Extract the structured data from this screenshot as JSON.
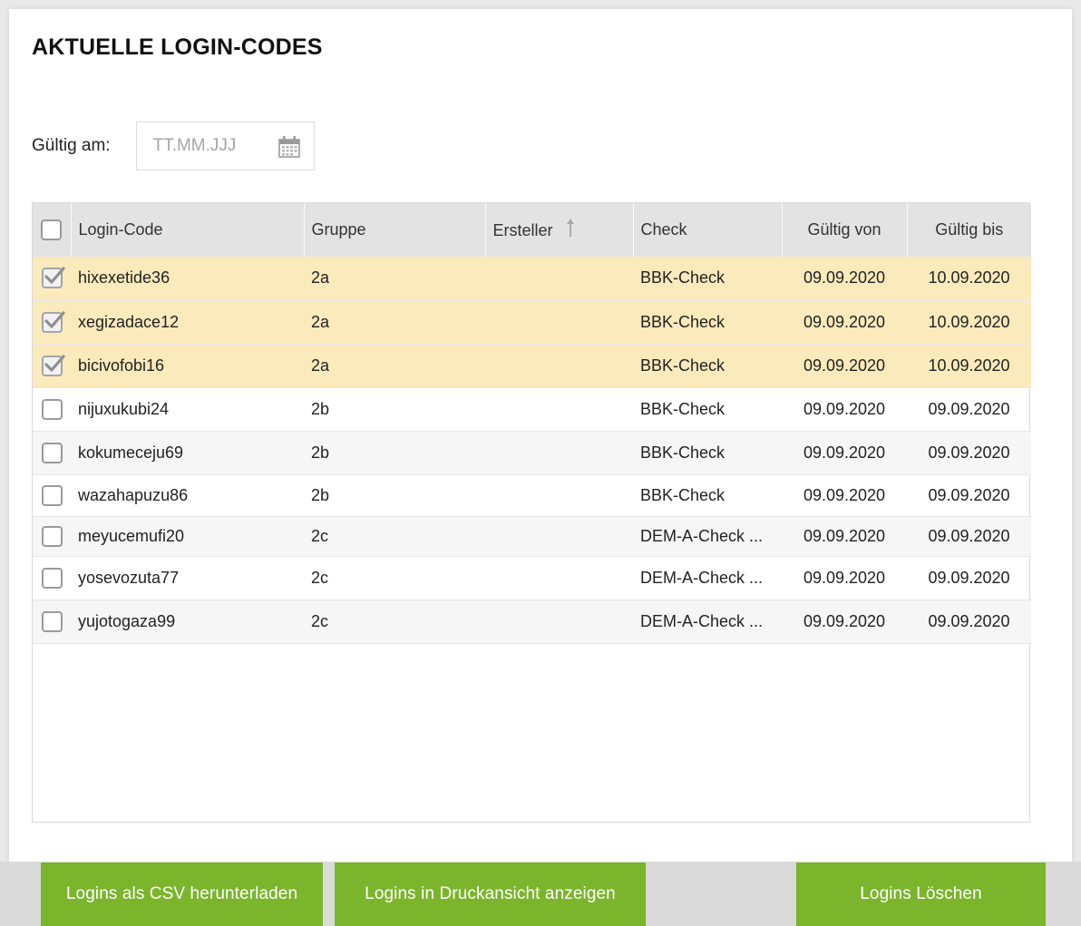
{
  "title": "AKTUELLE LOGIN-CODES",
  "filter": {
    "label": "Gültig am:",
    "placeholder": "TT.MM.JJJ"
  },
  "table": {
    "headers": {
      "code": "Login-Code",
      "group": "Gruppe",
      "creator": "Ersteller",
      "check": "Check",
      "valid_from": "Gültig von",
      "valid_to": "Gültig bis"
    },
    "rows": [
      {
        "selected": true,
        "code": "hixexetide36",
        "group": "2a",
        "creator": "",
        "check": "BBK-Check",
        "valid_from": "09.09.2020",
        "valid_to": "10.09.2020"
      },
      {
        "selected": true,
        "code": "xegizadace12",
        "group": "2a",
        "creator": "",
        "check": "BBK-Check",
        "valid_from": "09.09.2020",
        "valid_to": "10.09.2020"
      },
      {
        "selected": true,
        "code": "bicivofobi16",
        "group": "2a",
        "creator": "",
        "check": "BBK-Check",
        "valid_from": "09.09.2020",
        "valid_to": "10.09.2020"
      },
      {
        "selected": false,
        "code": "nijuxukubi24",
        "group": "2b",
        "creator": "",
        "check": "BBK-Check",
        "valid_from": "09.09.2020",
        "valid_to": "09.09.2020"
      },
      {
        "selected": false,
        "code": "kokumeceju69",
        "group": "2b",
        "creator": "",
        "check": "BBK-Check",
        "valid_from": "09.09.2020",
        "valid_to": "09.09.2020"
      },
      {
        "selected": false,
        "code": "wazahapuzu86",
        "group": "2b",
        "creator": "",
        "check": "BBK-Check",
        "valid_from": "09.09.2020",
        "valid_to": "09.09.2020"
      },
      {
        "selected": false,
        "code": "meyucemufi20",
        "group": "2c",
        "creator": "",
        "check": "DEM-A-Check ...",
        "valid_from": "09.09.2020",
        "valid_to": "09.09.2020"
      },
      {
        "selected": false,
        "code": "yosevozuta77",
        "group": "2c",
        "creator": "",
        "check": "DEM-A-Check ...",
        "valid_from": "09.09.2020",
        "valid_to": "09.09.2020"
      },
      {
        "selected": false,
        "code": "yujotogaza99",
        "group": "2c",
        "creator": "",
        "check": "DEM-A-Check ...",
        "valid_from": "09.09.2020",
        "valid_to": "09.09.2020"
      }
    ]
  },
  "buttons": {
    "csv": "Logins als CSV herunterladen",
    "print": "Logins in Druckansicht anzeigen",
    "delete": "Logins Löschen"
  },
  "colors": {
    "accent": "#7ab52b",
    "selected_row": "#fbeabb",
    "header_bg": "#e3e3e3"
  }
}
